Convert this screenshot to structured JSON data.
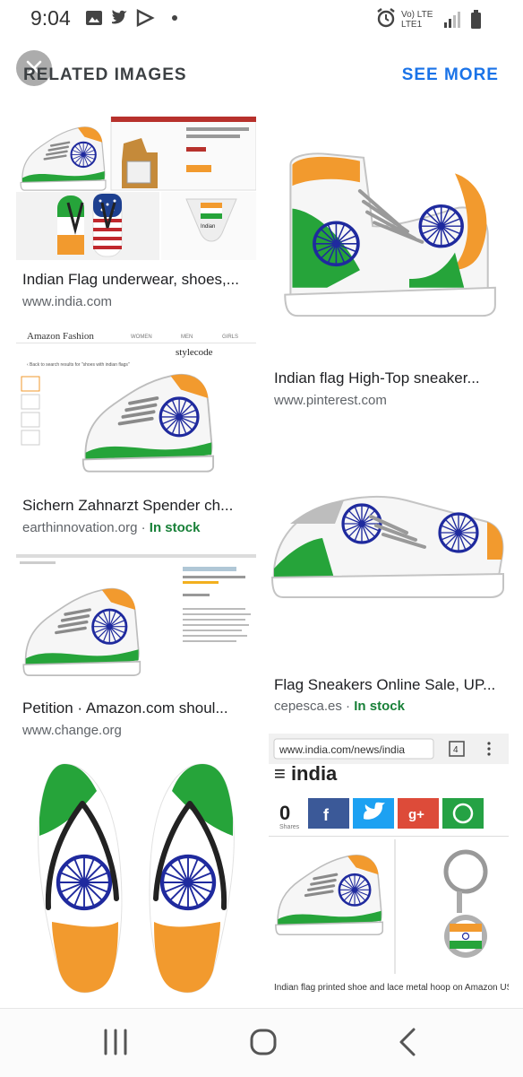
{
  "status_bar": {
    "time": "9:04",
    "network_top": "Vo) LTE",
    "network_bottom": "LTE1"
  },
  "header": {
    "title": "RELATED IMAGES",
    "see_more": "SEE MORE"
  },
  "results": [
    {
      "title": "Indian Flag underwear, shoes,...",
      "source": "www.india.com",
      "stock": ""
    },
    {
      "title": "Indian flag High-Top sneaker...",
      "source": "www.pinterest.com",
      "stock": ""
    },
    {
      "title": "Sichern Zahnarzt Spender ch...",
      "source": "earthinnovation.org",
      "stock": "In stock"
    },
    {
      "title": "Flag Sneakers Online Sale, UP...",
      "source": "cepesca.es",
      "stock": "In stock"
    },
    {
      "title": "Petition · Amazon.com shoul...",
      "source": "www.change.org",
      "stock": ""
    }
  ],
  "thumb_text": {
    "amazon_header": "Amazon Fashion",
    "amazon_women": "WOMEN",
    "amazon_men": "MEN",
    "amazon_girls": "GIRLS",
    "stylecode": "stylecode",
    "back_link": "‹ Back to search results for \"shoes with indian flags\"",
    "india_label": "Indian",
    "url_bar": "www.india.com/news/india",
    "tab_count": "4",
    "site_logo": "≡ india",
    "share_count": "0",
    "shares_label": "Shares",
    "caption": "Indian flag printed shoe and lace metal hoop on Amazon US site"
  },
  "colors": {
    "accent": "#1a73e8",
    "in_stock": "#188038",
    "saffron": "#f29a2e",
    "green": "#1f9a2f",
    "chakra": "#1f2a9e"
  },
  "icons": [
    "gallery-icon",
    "twitter-icon",
    "play-store-icon",
    "alarm-icon",
    "signal-icon",
    "battery-icon",
    "close-icon",
    "recents-icon",
    "home-icon",
    "back-icon"
  ]
}
